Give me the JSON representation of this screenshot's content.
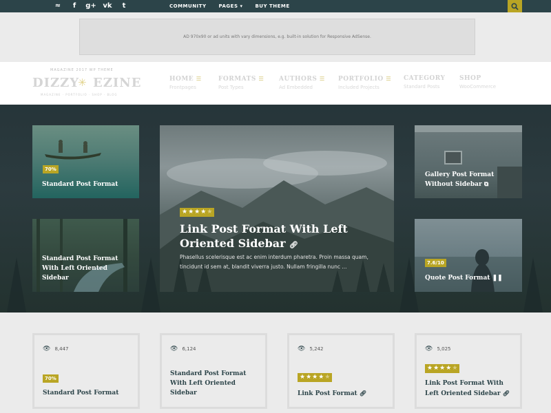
{
  "topbar": {
    "social_icons": [
      "rss-icon",
      "facebook-icon",
      "google-plus-icon",
      "vk-icon",
      "twitter-icon"
    ],
    "social_glyphs": [
      "≈",
      "f",
      "g+",
      "vk",
      "t"
    ],
    "nav": [
      "COMMUNITY",
      "PAGES",
      "BUY THEME"
    ],
    "pages_caret": "▾"
  },
  "ad": {
    "text": "AD 970x90 or ad units with vary dimensions, e.g. built-in solution for Responsive AdSense."
  },
  "logo": {
    "left": "DIZZY",
    "right": "EZINE",
    "year": "2017",
    "top": "MAGAZINE   2017   WP THEME",
    "bottom": "MAGAZINE · PORTFOLIO · SHOP · BLOG"
  },
  "mainnav": [
    {
      "label": "HOME",
      "sub": "Frontpages",
      "menu": true
    },
    {
      "label": "FORMATS",
      "sub": "Post Types",
      "menu": true
    },
    {
      "label": "AUTHORS",
      "sub": "Ad Embedded",
      "menu": true
    },
    {
      "label": "PORTFOLIO",
      "sub": "Included Projects",
      "menu": true
    },
    {
      "label": "CATEGORY",
      "sub": "Standard Posts",
      "menu": false
    },
    {
      "label": "SHOP",
      "sub": "WooCommerce",
      "menu": false
    }
  ],
  "hero": {
    "card1": {
      "badge": "70%",
      "title": "Standard Post Format"
    },
    "card2": {
      "title": "Standard Post Format With Left Oriented Sidebar"
    },
    "main": {
      "title": "Link Post Format With Left Oriented Sidebar",
      "excerpt": "Phasellus scelerisque est ac enim interdum pharetra. Proin massa quam, tincidunt id sem at, blandit viverra justo. Nullam fringilla nunc ...",
      "rating": 4
    },
    "card3": {
      "title": "Gallery Post Format Without Sidebar"
    },
    "card4": {
      "badge": "7.6/10",
      "title": "Quote Post Format"
    }
  },
  "bottom": [
    {
      "views": "8,447",
      "badge": "70%",
      "title": "Standard Post Format"
    },
    {
      "views": "6,124",
      "title": "Standard Post Format With Left Oriented Sidebar"
    },
    {
      "views": "5,242",
      "rating": 4.5,
      "title": "Link Post Format"
    },
    {
      "views": "5,025",
      "rating": 4,
      "title": "Link Post Format With Left Oriented Sidebar"
    }
  ],
  "colors": {
    "accent": "#b9a524",
    "dark": "#2c4449"
  }
}
